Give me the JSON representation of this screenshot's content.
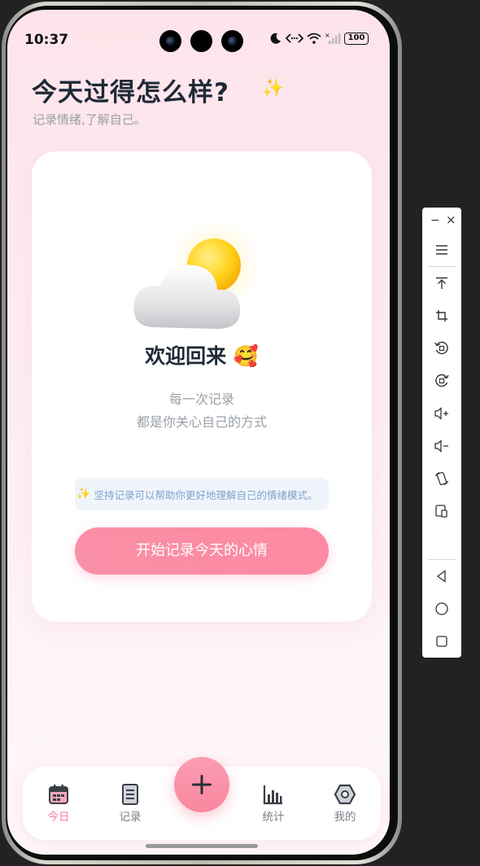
{
  "status_bar": {
    "time": "10:37",
    "battery": "100"
  },
  "header": {
    "title": "今天过得怎么样?",
    "sparkle": "✨",
    "subtitle": "记录情绪,了解自己。"
  },
  "card": {
    "welcome": "欢迎回来 🥰",
    "line1": "每一次记录",
    "line2": "都是你关心自己的方式",
    "tip_icon": "✨",
    "tip": "坚持记录可以帮助你更好地理解自己的情绪模式。",
    "start_button": "开始记录今天的心情"
  },
  "tabbar": {
    "tabs": [
      {
        "label": "今日",
        "icon": "calendar-icon",
        "active": true
      },
      {
        "label": "记录",
        "icon": "document-icon",
        "active": false
      },
      {
        "label": "统计",
        "icon": "bar-chart-icon",
        "active": false
      },
      {
        "label": "我的",
        "icon": "hexagon-icon",
        "active": false
      }
    ],
    "fab_icon": "plus-icon"
  },
  "colors": {
    "accent": "#f98fa6",
    "title": "#1f2937",
    "muted": "#9aa0a8",
    "tip_text": "#7da3cc"
  },
  "side_toolbar": {
    "minimize": "−",
    "close": "×",
    "icons": [
      "menu-icon",
      "pin-top-icon",
      "crop-icon",
      "rotate-left-icon",
      "rotate-right-icon",
      "volume-up-icon",
      "volume-down-icon",
      "rotate-device-icon",
      "screenshot-icon",
      "back-icon",
      "home-icon",
      "recents-icon"
    ]
  }
}
